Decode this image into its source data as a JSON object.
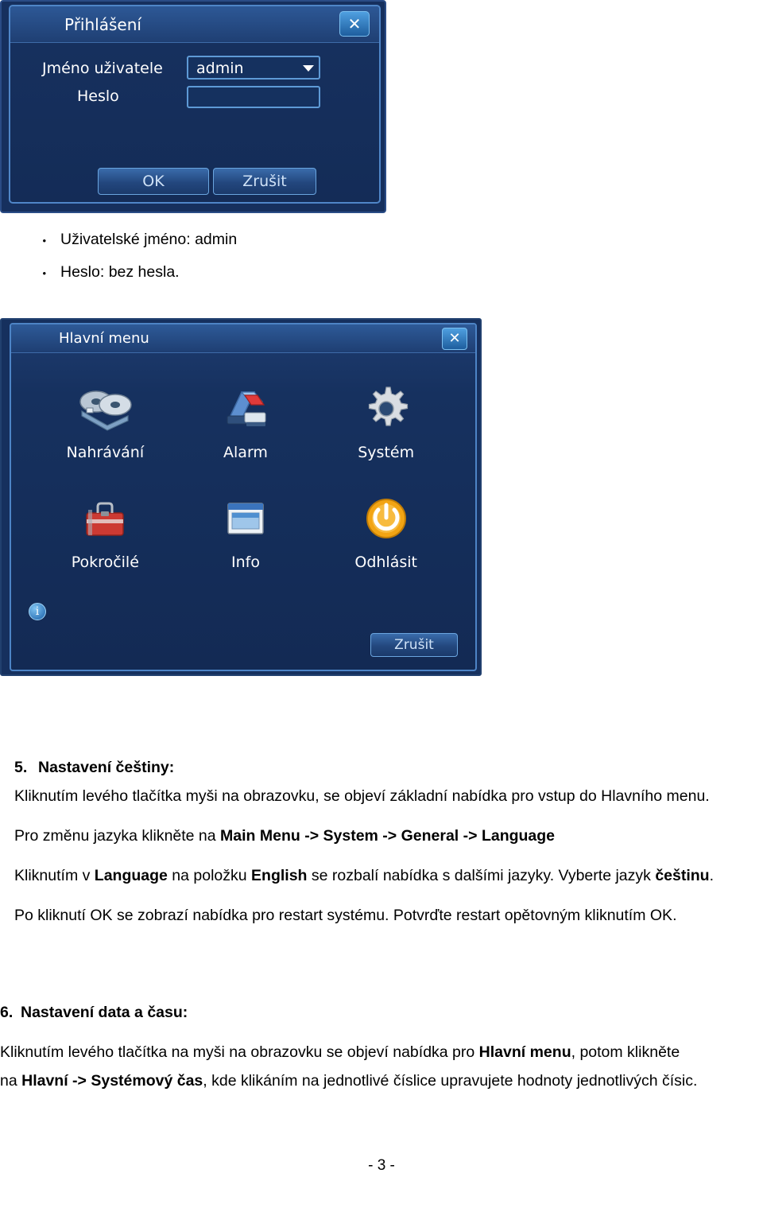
{
  "login_dialog": {
    "title": "Přihlášení",
    "close_icon": "close-icon",
    "username_label": "Jméno uživatele",
    "username_value": "admin",
    "password_label": "Heslo",
    "password_value": "",
    "ok_label": "OK",
    "cancel_label": "Zrušit"
  },
  "bullets": [
    {
      "marker": "•",
      "text": "Uživatelské jméno: admin"
    },
    {
      "marker": "•",
      "text": "Heslo: bez hesla."
    }
  ],
  "main_menu": {
    "title": "Hlavní menu",
    "close_icon": "close-icon",
    "items": [
      {
        "label": "Nahrávání",
        "icon": "film-reel-icon"
      },
      {
        "label": "Alarm",
        "icon": "alarm-light-icon"
      },
      {
        "label": "Systém",
        "icon": "gear-icon"
      },
      {
        "label": "Pokročilé",
        "icon": "toolbox-icon"
      },
      {
        "label": "Info",
        "icon": "monitor-window-icon"
      },
      {
        "label": "Odhlásit",
        "icon": "power-icon"
      }
    ],
    "cancel_label": "Zrušit",
    "info_badge": "i"
  },
  "document": {
    "section5": {
      "number": "5.",
      "heading": "Nastavení češtiny:",
      "p1": "Kliknutím levého tlačítka myši na obrazovku, se objeví základní nabídka pro vstup do Hlavního menu.",
      "p2_a": "Pro změnu jazyka klikněte na ",
      "p2_b": "Main Menu ->  System -> General -> Language",
      "p3_a": "Kliknutím v ",
      "p3_b": "Language",
      "p3_c": " na položku ",
      "p3_d": "English",
      "p3_e": " se rozbalí nabídka s dalšími jazyky. Vyberte jazyk ",
      "p3_f": "češtinu",
      "p3_g": ".",
      "p4": "Po kliknutí OK se zobrazí nabídka pro restart systému. Potvrďte restart opětovným kliknutím OK."
    },
    "section6": {
      "number": "6.",
      "heading": "Nastavení data a času:",
      "p1_a": "Kliknutím levého tlačítka na myši na obrazovku se objeví nabídka pro ",
      "p1_b": "Hlavní menu",
      "p1_c": ", potom klikněte",
      "p2_a": "na  ",
      "p2_b": "Hlavní -> Systémový čas",
      "p2_c": ", kde klikáním na jednotlivé číslice upravujete hodnoty jednotlivých čísic."
    },
    "page_number": "- 3 -"
  }
}
